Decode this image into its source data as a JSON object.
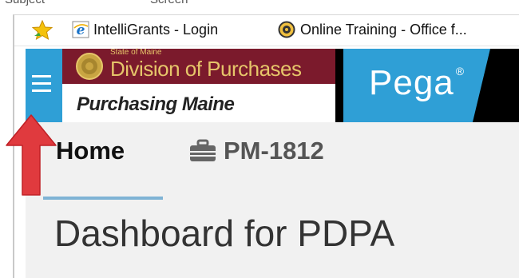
{
  "header_strip": {
    "left_label": "Subject",
    "right_label": "Screen"
  },
  "favorites": [
    {
      "label": "IntelliGrants - Login",
      "icon": "ie-icon"
    },
    {
      "label": "Online Training - Office f...",
      "icon": "gear-icon"
    }
  ],
  "app": {
    "brand_state": "State of Maine",
    "brand_division": "Division of Purchases",
    "brand_tagline": "Purchasing Maine",
    "vendor_logo": "Pega",
    "vendor_mark": "®"
  },
  "tabs": [
    {
      "label": "Home",
      "active": true
    },
    {
      "label": "PM-1812",
      "icon": "briefcase-icon",
      "active": false
    }
  ],
  "page_title": "Dashboard for PDPA",
  "colors": {
    "accent_blue": "#2f9fd6",
    "brand_maroon": "#7b1a2c",
    "brand_gold": "#e6c56a",
    "annotation_red": "#e03a3e"
  }
}
